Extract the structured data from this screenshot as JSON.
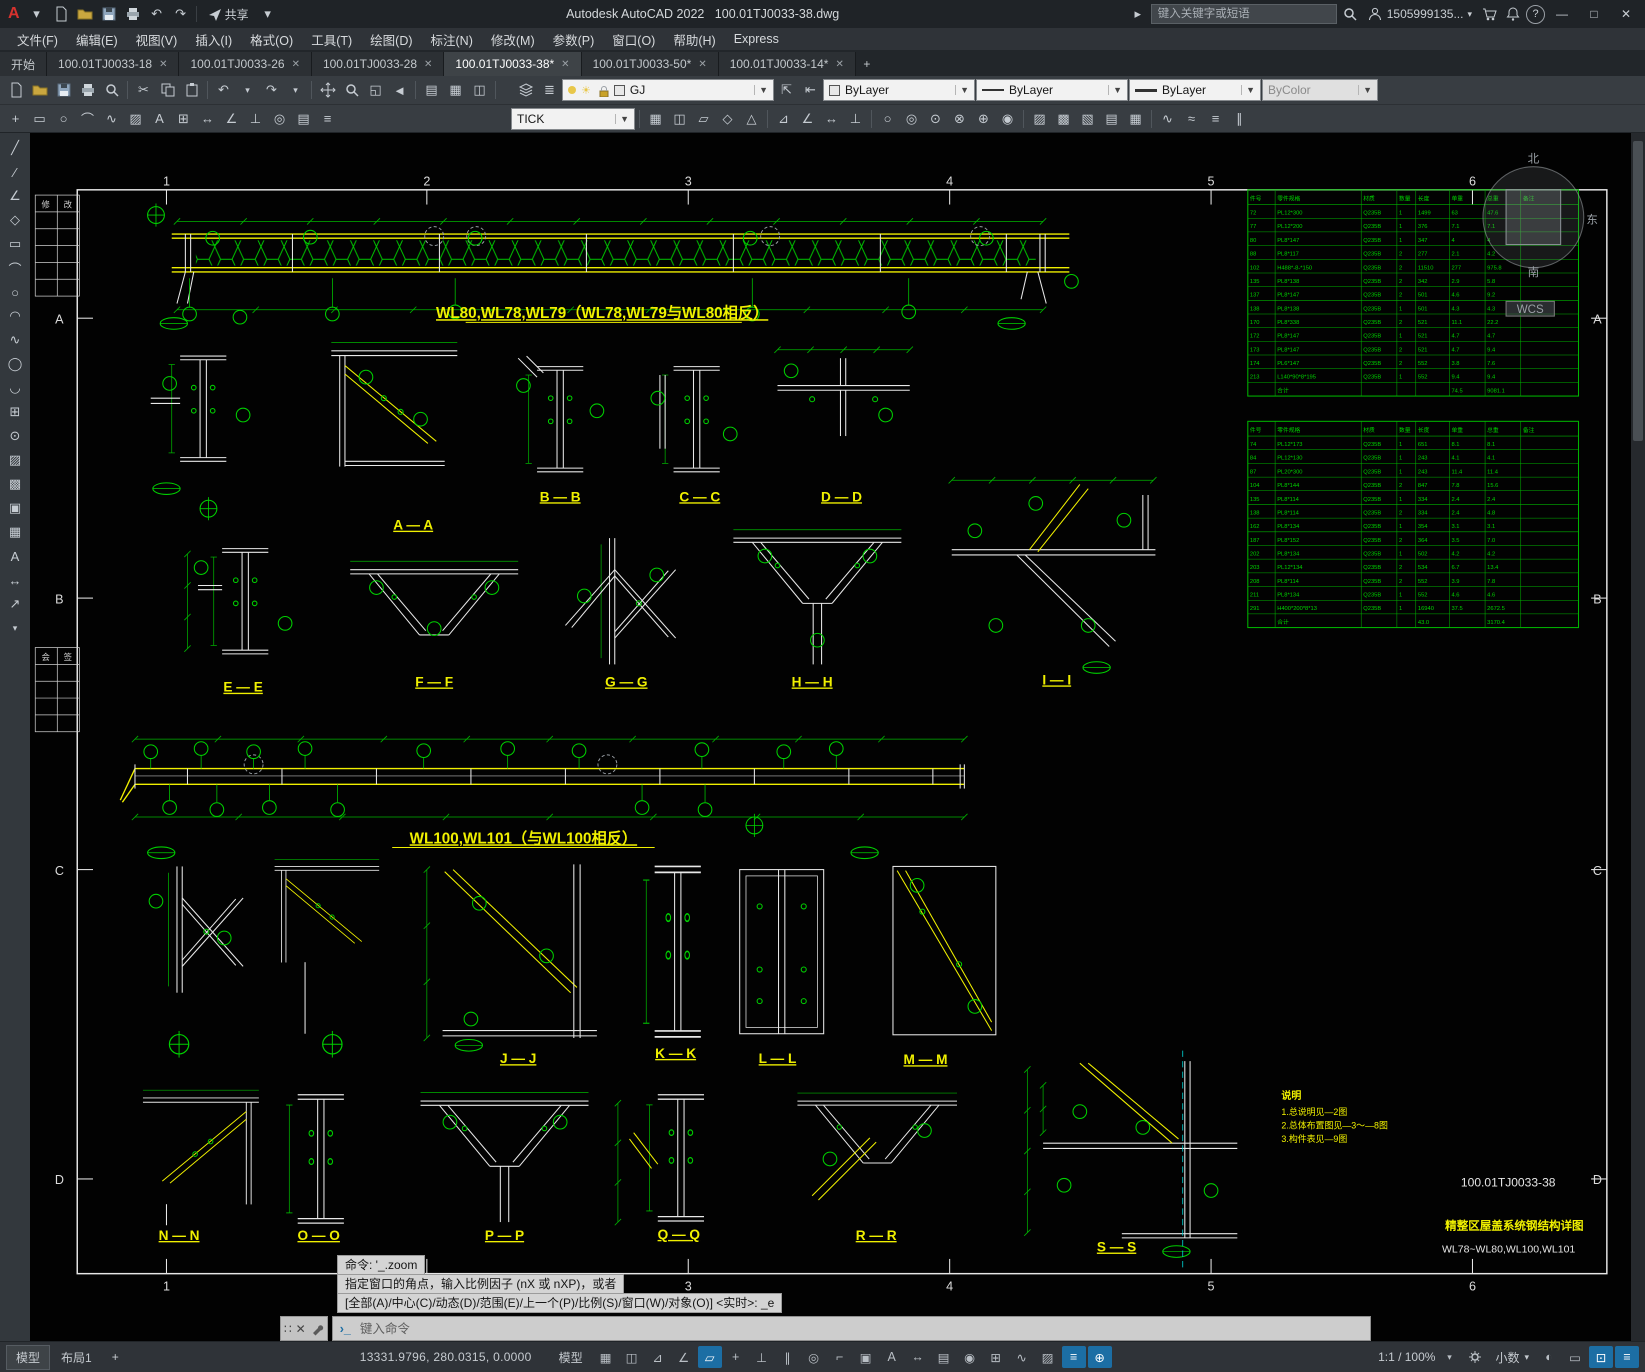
{
  "titlebar": {
    "app_title": "Autodesk AutoCAD 2022",
    "doc_title": "100.01TJ0033-38.dwg",
    "share_label": "共享",
    "search_placeholder": "键入关键字或短语",
    "account": "1505999135..."
  },
  "menubar": {
    "items": [
      "文件(F)",
      "编辑(E)",
      "视图(V)",
      "插入(I)",
      "格式(O)",
      "工具(T)",
      "绘图(D)",
      "标注(N)",
      "修改(M)",
      "参数(P)",
      "窗口(O)",
      "帮助(H)",
      "Express"
    ]
  },
  "tabs": {
    "start": "开始",
    "docs": [
      "100.01TJ0033-18",
      "100.01TJ0033-26",
      "100.01TJ0033-28",
      "100.01TJ0033-38*",
      "100.01TJ0033-50*",
      "100.01TJ0033-14*"
    ]
  },
  "toolbar": {
    "layer": "GJ",
    "color": "ByLayer",
    "linetype": "ByLayer",
    "lineweight": "ByLayer",
    "plotstyle": "ByColor",
    "dimstyle": "TICK"
  },
  "cmd": {
    "history": [
      "命令: '_.zoom",
      "指定窗口的角点，输入比例因子 (nX 或 nXP)，或者",
      "[全部(A)/中心(C)/动态(D)/范围(E)/上一个(P)/比例(S)/窗口(W)/对象(O)] <实时>: _e"
    ],
    "placeholder": "键入命令"
  },
  "status": {
    "model_tab": "模型",
    "layout_tab": "布局1",
    "new_layout": "+",
    "coords": "13331.9796, 280.0315, 0.0000",
    "model_badge": "模型",
    "scale": "1:1 / 100%",
    "units": "小数"
  },
  "drawing": {
    "axis_top": [
      "1",
      "2",
      "3",
      "4",
      "5",
      "6"
    ],
    "axis_side": [
      "A",
      "B",
      "C",
      "D"
    ],
    "beam1_title": "WL80,WL78,WL79（WL78,WL79与WL80相反）",
    "beam2_title": "WL100,WL101（与WL100相反）",
    "sections": [
      "A — A",
      "B — B",
      "C — C",
      "D — D",
      "E — E",
      "F — F",
      "G — G",
      "H — H",
      "I — I",
      "J — J",
      "K — K",
      "L — L",
      "M — M",
      "N — N",
      "O — O",
      "P — P",
      "Q — Q",
      "R — R",
      "S — S"
    ],
    "notes_title": "说明",
    "notes": [
      "1.总说明见—2图",
      "2.总体布置图见—3～—8图",
      "3.构件表见—9图"
    ],
    "dwg_no": "100.01TJ0033-38",
    "dwg_title": "精整区屋盖系统钢结构详图",
    "dwg_sub": "WL78~WL80,WL100,WL101",
    "compass": {
      "n": "北",
      "e": "东",
      "s": "南",
      "wcs": "WCS"
    },
    "margin": {
      "rev": [
        "修",
        "改"
      ],
      "sign": [
        "会",
        "签"
      ]
    },
    "tables": [
      {
        "header": [
          "件号",
          "零件规格",
          "材质",
          "数量",
          "长度",
          "单重",
          "总重",
          "备注"
        ],
        "rows": [
          [
            "72",
            "PL12*300",
            "Q235B",
            "1",
            "1499",
            "63",
            "47.6",
            ""
          ],
          [
            "77",
            "PL12*200",
            "Q235B",
            "1",
            "376",
            "7.1",
            "7.1",
            ""
          ],
          [
            "80",
            "PL8*147",
            "Q235B",
            "1",
            "347",
            "4",
            "4",
            ""
          ],
          [
            "88",
            "PL8*117",
            "Q235B",
            "2",
            "277",
            "2.1",
            "4.2",
            ""
          ],
          [
            "102",
            "H488*-8-*150",
            "Q235B",
            "2",
            "11510",
            "277",
            "975.8",
            ""
          ],
          [
            "135",
            "PL8*138",
            "Q235B",
            "2",
            "342",
            "2.9",
            "5.8",
            ""
          ],
          [
            "137",
            "PL8*147",
            "Q235B",
            "2",
            "501",
            "4.6",
            "9.2",
            ""
          ],
          [
            "138",
            "PL8*138",
            "Q235B",
            "1",
            "501",
            "4.3",
            "4.3",
            ""
          ],
          [
            "170",
            "PL8*338",
            "Q235B",
            "2",
            "521",
            "11.1",
            "22.2",
            ""
          ],
          [
            "172",
            "PL8*147",
            "Q235B",
            "1",
            "521",
            "4.7",
            "4.7",
            ""
          ],
          [
            "173",
            "PL8*147",
            "Q235B",
            "2",
            "521",
            "4.7",
            "9.4",
            ""
          ],
          [
            "174",
            "PL6*147",
            "Q235B",
            "2",
            "552",
            "3.8",
            "7.6",
            ""
          ],
          [
            "213",
            "L140*90*8*195",
            "Q235B",
            "1",
            "552",
            "9.4",
            "9.4",
            ""
          ]
        ],
        "totals": [
          "",
          "合计",
          "",
          "",
          "",
          "74.5",
          "9081.1",
          ""
        ]
      },
      {
        "header": [
          "件号",
          "零件规格",
          "材质",
          "数量",
          "长度",
          "单重",
          "总重",
          "备注"
        ],
        "rows": [
          [
            "74",
            "PL12*173",
            "Q235B",
            "1",
            "651",
            "8.1",
            "8.1",
            ""
          ],
          [
            "84",
            "PL12*130",
            "Q235B",
            "1",
            "243",
            "4.1",
            "4.1",
            ""
          ],
          [
            "87",
            "PL20*300",
            "Q235B",
            "1",
            "243",
            "11.4",
            "11.4",
            ""
          ],
          [
            "104",
            "PL8*144",
            "Q235B",
            "2",
            "847",
            "7.8",
            "15.6",
            ""
          ],
          [
            "135",
            "PL8*114",
            "Q235B",
            "1",
            "334",
            "2.4",
            "2.4",
            ""
          ],
          [
            "138",
            "PL8*114",
            "Q235B",
            "2",
            "334",
            "2.4",
            "4.8",
            ""
          ],
          [
            "162",
            "PL8*134",
            "Q235B",
            "1",
            "354",
            "3.1",
            "3.1",
            ""
          ],
          [
            "187",
            "PL8*152",
            "Q235B",
            "2",
            "364",
            "3.5",
            "7.0",
            ""
          ],
          [
            "202",
            "PL8*134",
            "Q235B",
            "1",
            "502",
            "4.2",
            "4.2",
            ""
          ],
          [
            "203",
            "PL12*134",
            "Q235B",
            "2",
            "534",
            "6.7",
            "13.4",
            ""
          ],
          [
            "208",
            "PL8*114",
            "Q235B",
            "2",
            "552",
            "3.9",
            "7.8",
            ""
          ],
          [
            "211",
            "PL8*134",
            "Q235B",
            "1",
            "552",
            "4.6",
            "4.6",
            ""
          ],
          [
            "291",
            "H400*200*8*13",
            "Q235B",
            "1",
            "16940",
            "37.5",
            "2672.5",
            ""
          ]
        ],
        "totals": [
          "",
          "合计",
          "",
          "",
          "43.0",
          "",
          "3170.4",
          ""
        ]
      }
    ]
  }
}
